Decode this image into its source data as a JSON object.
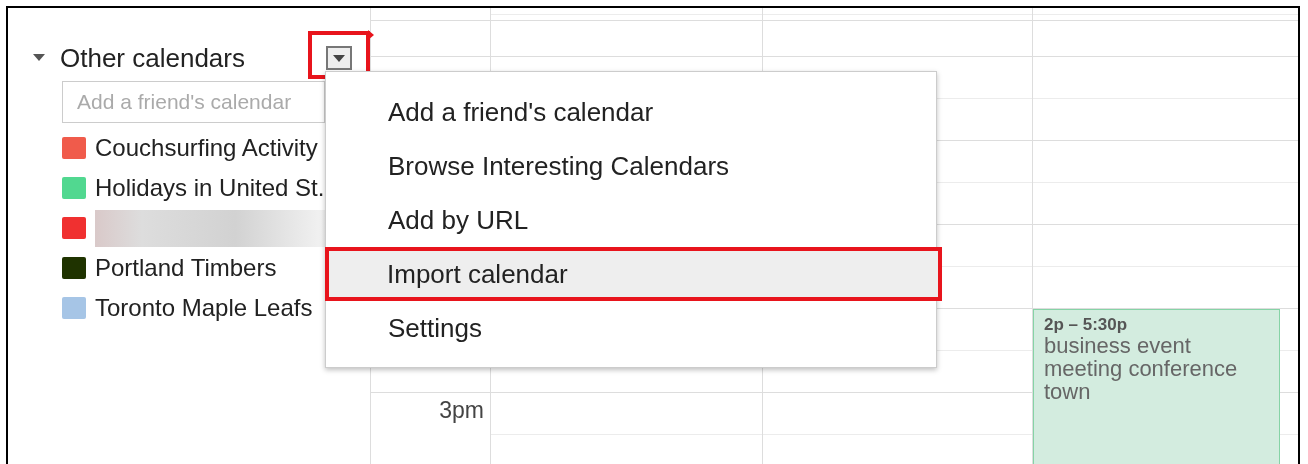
{
  "sidebar": {
    "section": {
      "title": "Other calendars",
      "expanded": true,
      "menu_button": {
        "outlined": true
      }
    },
    "add_field": {
      "placeholder": "Add a friend's calendar"
    },
    "calendars": [
      {
        "kind": "calendar",
        "name": "Couchsurfing Activity",
        "color": "#f05b4b"
      },
      {
        "kind": "calendar",
        "name": "Holidays in United St.",
        "color": "#51d890"
      },
      {
        "kind": "blurred",
        "color": "#f03030"
      },
      {
        "kind": "calendar",
        "name": "Portland Timbers",
        "color": "#1f3300"
      },
      {
        "kind": "calendar",
        "name": "Toronto Maple Leafs",
        "color": "#a6c5e6"
      }
    ]
  },
  "grid": {
    "time_labels": [
      "3pm"
    ],
    "events": [
      {
        "time": "2p – 5:30p",
        "title": "business event meeting conference town"
      }
    ]
  },
  "menu": {
    "items": [
      {
        "label": "Add a friend's calendar",
        "selected": false,
        "outlined": false
      },
      {
        "label": "Browse Interesting Calendars",
        "selected": false,
        "outlined": false
      },
      {
        "label": "Add by URL",
        "selected": false,
        "outlined": false
      },
      {
        "label": "Import calendar",
        "selected": true,
        "outlined": true
      },
      {
        "label": "Settings",
        "selected": false,
        "outlined": false
      }
    ]
  }
}
